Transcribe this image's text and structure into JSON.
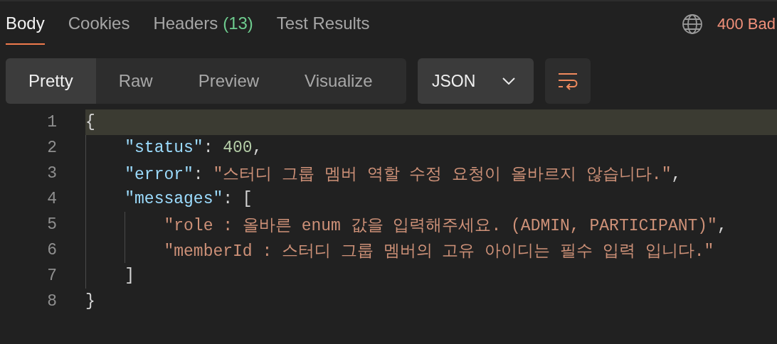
{
  "tabs": [
    {
      "label": "Body",
      "selected": true
    },
    {
      "label": "Cookies",
      "selected": false
    },
    {
      "label": "Headers",
      "count": "(13)",
      "selected": false
    },
    {
      "label": "Test Results",
      "selected": false
    }
  ],
  "status": "400 Bad",
  "view_modes": [
    {
      "label": "Pretty",
      "selected": true
    },
    {
      "label": "Raw",
      "selected": false
    },
    {
      "label": "Preview",
      "selected": false
    },
    {
      "label": "Visualize",
      "selected": false
    }
  ],
  "format_dropdown": {
    "value": "JSON"
  },
  "code_lines": [
    {
      "number": "1",
      "highlighted": true,
      "tokens": [
        {
          "kind": "punct",
          "text": "{"
        }
      ]
    },
    {
      "number": "2",
      "highlighted": false,
      "tokens": [
        {
          "kind": "key",
          "text": "    \"status\""
        },
        {
          "kind": "punct",
          "text": ": "
        },
        {
          "kind": "number",
          "text": "400"
        },
        {
          "kind": "punct",
          "text": ","
        }
      ]
    },
    {
      "number": "3",
      "highlighted": false,
      "tokens": [
        {
          "kind": "key",
          "text": "    \"error\""
        },
        {
          "kind": "punct",
          "text": ": "
        },
        {
          "kind": "string",
          "text": "\"스터디 그룹 멤버 역할 수정 요청이 올바르지 않습니다.\""
        },
        {
          "kind": "punct",
          "text": ","
        }
      ]
    },
    {
      "number": "4",
      "highlighted": false,
      "tokens": [
        {
          "kind": "key",
          "text": "    \"messages\""
        },
        {
          "kind": "punct",
          "text": ": ["
        }
      ]
    },
    {
      "number": "5",
      "highlighted": false,
      "tokens": [
        {
          "kind": "string",
          "text": "        \"role : 올바른 enum 값을 입력해주세요. (ADMIN, PARTICIPANT)\""
        },
        {
          "kind": "punct",
          "text": ","
        }
      ]
    },
    {
      "number": "6",
      "highlighted": false,
      "tokens": [
        {
          "kind": "string",
          "text": "        \"memberId : 스터디 그룹 멤버의 고유 아이디는 필수 입력 입니다.\""
        }
      ]
    },
    {
      "number": "7",
      "highlighted": false,
      "tokens": [
        {
          "kind": "punct",
          "text": "    ]"
        }
      ]
    },
    {
      "number": "8",
      "highlighted": false,
      "tokens": [
        {
          "kind": "punct",
          "text": "}"
        }
      ]
    }
  ]
}
